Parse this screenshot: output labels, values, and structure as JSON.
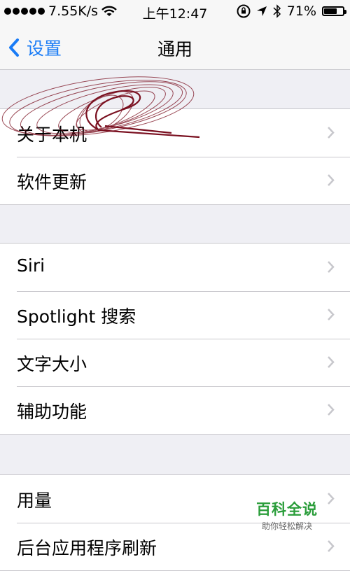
{
  "status_bar": {
    "speed": "7.55K/s",
    "time": "上午12:47",
    "battery": "71%",
    "battery_level": 0.71,
    "signal_bars": 5
  },
  "nav": {
    "back_label": "设置",
    "title": "通用"
  },
  "groups": [
    {
      "items": [
        {
          "label": "关于本机"
        },
        {
          "label": "软件更新"
        }
      ]
    },
    {
      "items": [
        {
          "label": "Siri"
        },
        {
          "label": "Spotlight 搜索"
        },
        {
          "label": "文字大小"
        },
        {
          "label": "辅助功能"
        }
      ]
    },
    {
      "items": [
        {
          "label": "用量"
        },
        {
          "label": "后台应用程序刷新"
        }
      ]
    }
  ],
  "watermark": {
    "title": "百科全说",
    "subtitle": "助你轻松解决"
  },
  "colors": {
    "accent": "#1a7cf6",
    "background": "#efeff4",
    "chevron": "#c7c7cc",
    "scribble": "#7a1020"
  },
  "icons": [
    "wifi-icon",
    "lock-rotation-icon",
    "location-arrow-icon",
    "bluetooth-icon",
    "battery-icon",
    "chevron-left-icon",
    "chevron-right-icon"
  ]
}
